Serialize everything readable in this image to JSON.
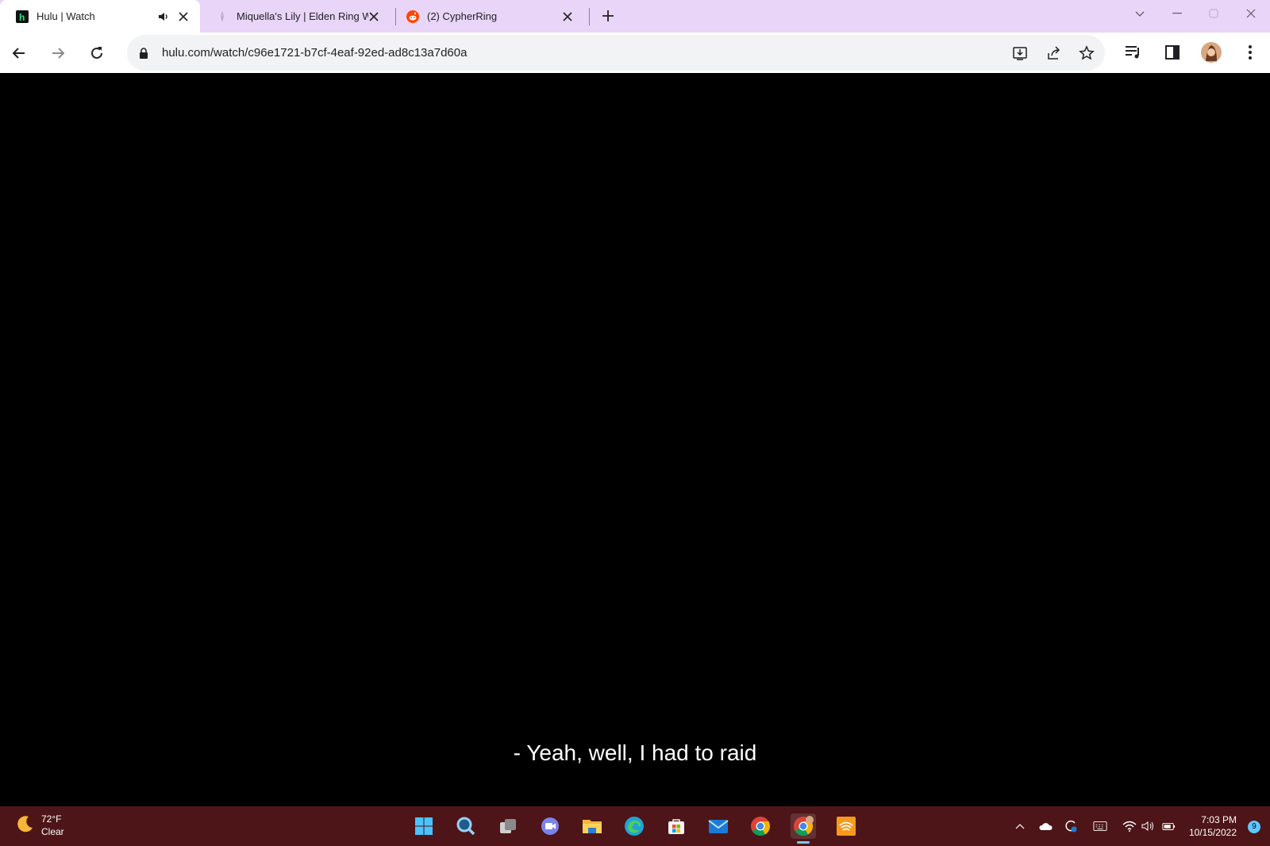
{
  "browser": {
    "tabs": [
      {
        "title": "Hulu | Watch",
        "favicon": "hulu-icon",
        "active": true,
        "audio": true
      },
      {
        "title": "Miquella's Lily | Elden Ring Wik",
        "favicon": "lily-icon",
        "active": false
      },
      {
        "title": "(2) CypherRing",
        "favicon": "reddit-icon",
        "active": false
      }
    ],
    "url": "hulu.com/watch/c96e1721-b7cf-4eaf-92ed-ad8c13a7d60a",
    "tabstrip_color": "#e9d5f7"
  },
  "video": {
    "subtitle": "- Yeah, well, I had to raid"
  },
  "taskbar": {
    "weather_temp": "72°F",
    "weather_desc": "Clear",
    "time": "7:03 PM",
    "date": "10/15/2022",
    "notification_count": "9",
    "background": "#4d1517"
  }
}
